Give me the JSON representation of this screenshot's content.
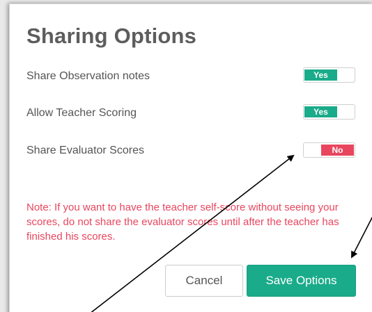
{
  "dialog": {
    "title": "Sharing Options",
    "options": [
      {
        "label": "Share Observation notes",
        "state": "Yes"
      },
      {
        "label": "Allow Teacher Scoring",
        "state": "Yes"
      },
      {
        "label": "Share Evaluator Scores",
        "state": "No"
      }
    ],
    "note": "Note: If you want to have the teacher self-score without seeing your scores, do not share the evaluator scores until after the teacher has finished his scores.",
    "cancel_label": "Cancel",
    "save_label": "Save Options"
  },
  "colors": {
    "accent_green": "#1aab8a",
    "accent_red": "#e8465e",
    "title_gray": "#5d5d5d",
    "text_gray": "#555555"
  }
}
